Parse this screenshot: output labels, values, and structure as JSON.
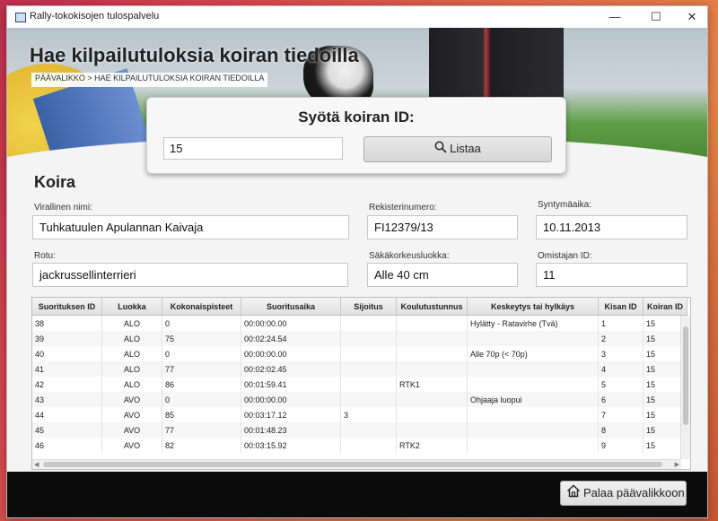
{
  "window": {
    "title": "Rally-tokokisojen tulospalvelu"
  },
  "header": {
    "title": "Hae kilpailutuloksia koiran tiedoilla",
    "breadcrumb": "PÄÄVALIKKO > HAE KILPAILUTULOKSIA KOIRAN TIEDOILLA"
  },
  "search": {
    "heading": "Syötä koiran ID:",
    "value": "15",
    "button_label": "Listaa",
    "button_icon": "search-icon"
  },
  "dog": {
    "section_title": "Koira",
    "fields": {
      "official_name": {
        "label": "Virallinen nimi:",
        "value": "Tuhkatuulen Apulannan Kaivaja"
      },
      "registration": {
        "label": "Rekisterinumero:",
        "value": "FI12379/13"
      },
      "birth_date": {
        "label": "Syntymäaika:",
        "value": "10.11.2013"
      },
      "breed": {
        "label": "Rotu:",
        "value": "jackrussellinterrieri"
      },
      "height_class": {
        "label": "Säkäkorkeusluokka:",
        "value": "Alle 40 cm"
      },
      "owner_id": {
        "label": "Omistajan ID:",
        "value": "11"
      }
    }
  },
  "results": {
    "columns": [
      "Suorituksen ID",
      "Luokka",
      "Kokonaispisteet",
      "Suoritusaika",
      "Sijoitus",
      "Koulutustunnus",
      "Keskeytys tai hylkäys",
      "Kisan ID",
      "Koiran ID"
    ],
    "rows": [
      [
        "38",
        "ALO",
        "0",
        "00:00:00.00",
        "",
        "",
        "Hylätty - Ratavirhe (Tvä)",
        "1",
        "15"
      ],
      [
        "39",
        "ALO",
        "75",
        "00:02:24.54",
        "",
        "",
        "",
        "2",
        "15"
      ],
      [
        "40",
        "ALO",
        "0",
        "00:00:00.00",
        "",
        "",
        "Alle 70p (< 70p)",
        "3",
        "15"
      ],
      [
        "41",
        "ALO",
        "77",
        "00:02:02.45",
        "",
        "",
        "",
        "4",
        "15"
      ],
      [
        "42",
        "ALO",
        "86",
        "00:01:59.41",
        "",
        "RTK1",
        "",
        "5",
        "15"
      ],
      [
        "43",
        "AVO",
        "0",
        "00:00:00.00",
        "",
        "",
        "Ohjaaja luopui",
        "6",
        "15"
      ],
      [
        "44",
        "AVO",
        "85",
        "00:03:17.12",
        "3",
        "",
        "",
        "7",
        "15"
      ],
      [
        "45",
        "AVO",
        "77",
        "00:01:48.23",
        "",
        "",
        "",
        "8",
        "15"
      ],
      [
        "46",
        "AVO",
        "82",
        "00:03:15.92",
        "",
        "RTK2",
        "",
        "9",
        "15"
      ]
    ]
  },
  "footer": {
    "back_label": "Palaa päävalikkoon",
    "back_icon": "home-icon"
  }
}
